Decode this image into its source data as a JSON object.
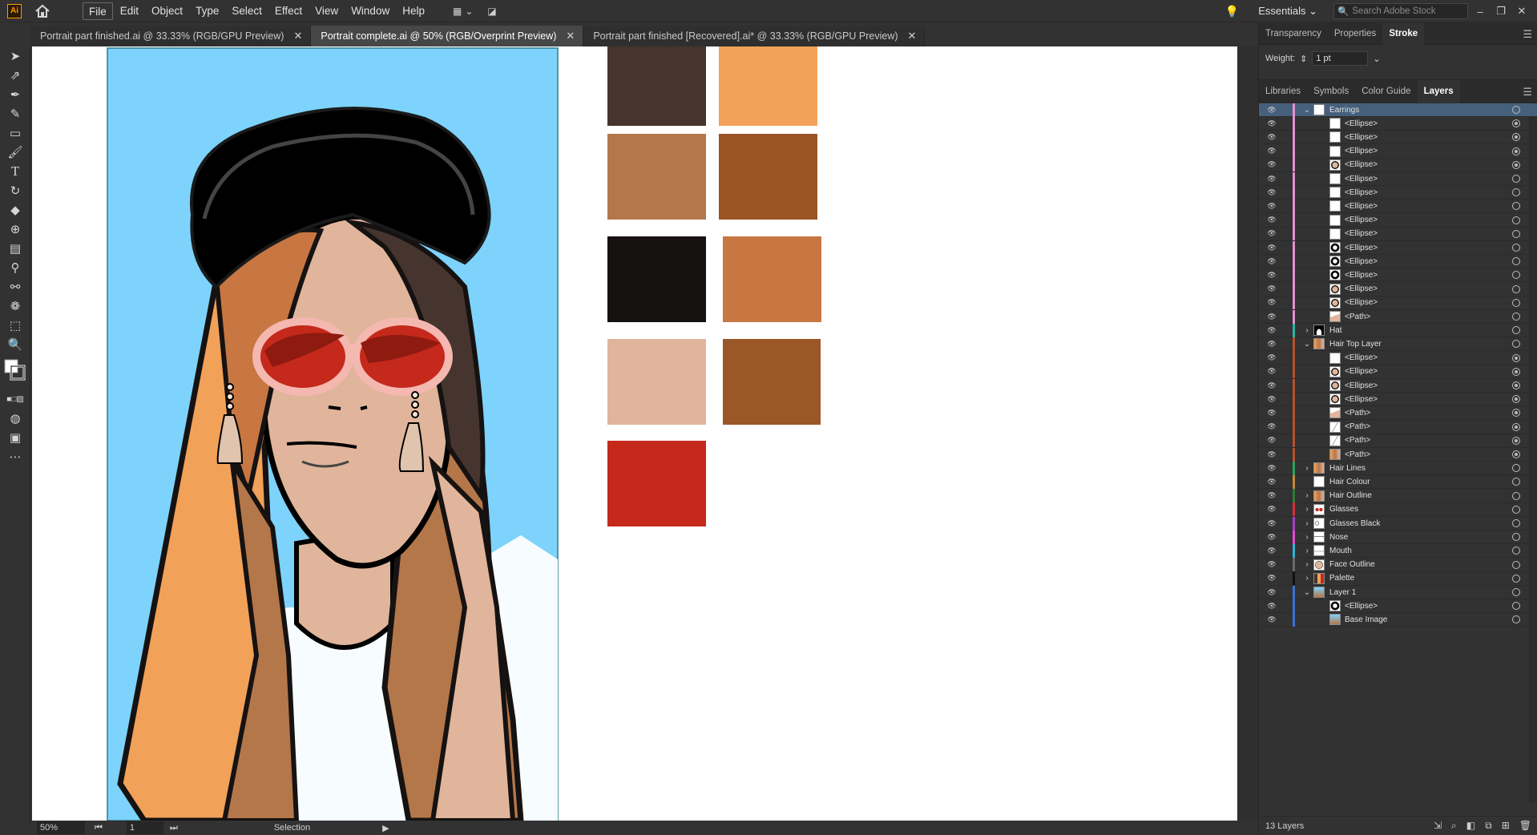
{
  "app": {
    "logo": "Ai"
  },
  "menu": [
    "File",
    "Edit",
    "Object",
    "Type",
    "Select",
    "Effect",
    "View",
    "Window",
    "Help"
  ],
  "workspace": "Essentials",
  "search_placeholder": "Search Adobe Stock",
  "tabs": [
    {
      "label": "Portrait part finished.ai @ 33.33% (RGB/GPU Preview)",
      "active": false
    },
    {
      "label": "Portrait complete.ai @ 50% (RGB/Overprint Preview)",
      "active": true
    },
    {
      "label": "Portrait part finished [Recovered].ai* @ 33.33% (RGB/GPU Preview)",
      "active": false
    }
  ],
  "tools": [
    "selection-tool",
    "direct-selection-tool",
    "pen-tool",
    "curvature-tool",
    "rectangle-tool",
    "paintbrush-tool",
    "type-tool",
    "rotate-tool",
    "eraser-tool",
    "shape-builder-tool",
    "gradient-tool",
    "eyedropper-tool",
    "blend-tool",
    "symbol-sprayer-tool",
    "artboard-tool",
    "zoom-tool",
    "fill-stroke-swatch",
    "edit-toolbar"
  ],
  "swatches": [
    "#45352e",
    "#f2a159",
    "#b4774a",
    "#9a5426",
    "#161212",
    "#c87742",
    "#e0b59b",
    "#9b5728",
    "#c4291b"
  ],
  "illustration": {
    "background": "#7dd3fb",
    "hat": "#000000",
    "skin": "#e0b59b",
    "hair_light": "#f2a159",
    "hair_mid": "#b4774a",
    "hair_dark": "#45352e",
    "lens": "#c4291b",
    "frame": "#f4b8b0"
  },
  "panel": {
    "top_tabs": [
      "Transparency",
      "Properties",
      "Stroke"
    ],
    "active_top_tab": "Stroke",
    "weight_label": "Weight:",
    "weight_value": "1 pt",
    "lower_tabs": [
      "Libraries",
      "Symbols",
      "Color Guide",
      "Layers"
    ],
    "active_lower_tab": "Layers"
  },
  "layers": [
    {
      "name": "Earrings",
      "level": 0,
      "expand": "open",
      "color": "#e38fd0",
      "selected": true,
      "thumb": "white"
    },
    {
      "name": "<Ellipse>",
      "level": 1,
      "color": "#e38fd0",
      "thumb": "white",
      "target_filled": true
    },
    {
      "name": "<Ellipse>",
      "level": 1,
      "color": "#e38fd0",
      "thumb": "white",
      "target_filled": true
    },
    {
      "name": "<Ellipse>",
      "level": 1,
      "color": "#e38fd0",
      "thumb": "white",
      "target_filled": true
    },
    {
      "name": "<Ellipse>",
      "level": 1,
      "color": "#e38fd0",
      "thumb": "ring",
      "target_filled": true
    },
    {
      "name": "<Ellipse>",
      "level": 1,
      "color": "#e38fd0",
      "thumb": "white",
      "target_filled": false
    },
    {
      "name": "<Ellipse>",
      "level": 1,
      "color": "#e38fd0",
      "thumb": "white",
      "target_filled": false
    },
    {
      "name": "<Ellipse>",
      "level": 1,
      "color": "#e38fd0",
      "thumb": "white",
      "target_filled": false
    },
    {
      "name": "<Ellipse>",
      "level": 1,
      "color": "#e38fd0",
      "thumb": "white",
      "target_filled": false
    },
    {
      "name": "<Ellipse>",
      "level": 1,
      "color": "#e38fd0",
      "thumb": "white",
      "target_filled": false
    },
    {
      "name": "<Ellipse>",
      "level": 1,
      "color": "#e38fd0",
      "thumb": "ring-dark",
      "target_filled": false
    },
    {
      "name": "<Ellipse>",
      "level": 1,
      "color": "#e38fd0",
      "thumb": "ring-dark",
      "target_filled": false
    },
    {
      "name": "<Ellipse>",
      "level": 1,
      "color": "#e38fd0",
      "thumb": "ring-dark",
      "target_filled": false
    },
    {
      "name": "<Ellipse>",
      "level": 1,
      "color": "#e38fd0",
      "thumb": "ring",
      "target_filled": false
    },
    {
      "name": "<Ellipse>",
      "level": 1,
      "color": "#e38fd0",
      "thumb": "ring",
      "target_filled": false
    },
    {
      "name": "<Path>",
      "level": 1,
      "color": "#e38fd0",
      "thumb": "tassel",
      "target_filled": false
    },
    {
      "name": "Hat",
      "level": 0,
      "expand": "closed",
      "color": "#2bb5a5",
      "thumb": "hat"
    },
    {
      "name": "Hair Top Layer",
      "level": 0,
      "expand": "open",
      "color": "#b5502e",
      "thumb": "hair"
    },
    {
      "name": "<Ellipse>",
      "level": 1,
      "color": "#b5502e",
      "thumb": "white",
      "target_filled": true
    },
    {
      "name": "<Ellipse>",
      "level": 1,
      "color": "#b5502e",
      "thumb": "ring",
      "target_filled": true
    },
    {
      "name": "<Ellipse>",
      "level": 1,
      "color": "#b5502e",
      "thumb": "ring",
      "target_filled": true
    },
    {
      "name": "<Ellipse>",
      "level": 1,
      "color": "#b5502e",
      "thumb": "ring",
      "target_filled": true
    },
    {
      "name": "<Path>",
      "level": 1,
      "color": "#b5502e",
      "thumb": "tassel",
      "target_filled": true
    },
    {
      "name": "<Path>",
      "level": 1,
      "color": "#b5502e",
      "thumb": "line",
      "target_filled": true
    },
    {
      "name": "<Path>",
      "level": 1,
      "color": "#b5502e",
      "thumb": "line",
      "target_filled": true
    },
    {
      "name": "<Path>",
      "level": 1,
      "color": "#b5502e",
      "thumb": "hair",
      "target_filled": true
    },
    {
      "name": "Hair Lines",
      "level": 0,
      "expand": "closed",
      "color": "#2ba35b",
      "thumb": "hair"
    },
    {
      "name": "Hair Colour",
      "level": 0,
      "expand": "none",
      "color": "#c08a3a",
      "thumb": "white"
    },
    {
      "name": "Hair Outline",
      "level": 0,
      "expand": "closed",
      "color": "#2f7a3a",
      "thumb": "hair"
    },
    {
      "name": "Glasses",
      "level": 0,
      "expand": "closed",
      "color": "#d92d3a",
      "thumb": "glasses"
    },
    {
      "name": "Glasses Black",
      "level": 0,
      "expand": "closed",
      "color": "#a73ec4",
      "thumb": "glasses-black"
    },
    {
      "name": "Nose",
      "level": 0,
      "expand": "closed",
      "color": "#e04bd1",
      "thumb": "nose"
    },
    {
      "name": "Mouth",
      "level": 0,
      "expand": "closed",
      "color": "#2fb3d6",
      "thumb": "mouth"
    },
    {
      "name": "Face Outline",
      "level": 0,
      "expand": "closed",
      "color": "#6b6b6b",
      "thumb": "face"
    },
    {
      "name": "Palette",
      "level": 0,
      "expand": "closed",
      "color": "#111111",
      "thumb": "palette"
    },
    {
      "name": "Layer 1",
      "level": 0,
      "expand": "open",
      "color": "#3d6fd6",
      "thumb": "portrait"
    },
    {
      "name": "<Ellipse>",
      "level": 1,
      "color": "#3d6fd6",
      "thumb": "ring-dark",
      "target_filled": false
    },
    {
      "name": "Base Image",
      "level": 1,
      "color": "#3d6fd6",
      "thumb": "portrait",
      "target_filled": false
    }
  ],
  "layers_count": "13 Layers",
  "status": {
    "zoom": "50%",
    "page": "1",
    "mode": "Selection"
  }
}
